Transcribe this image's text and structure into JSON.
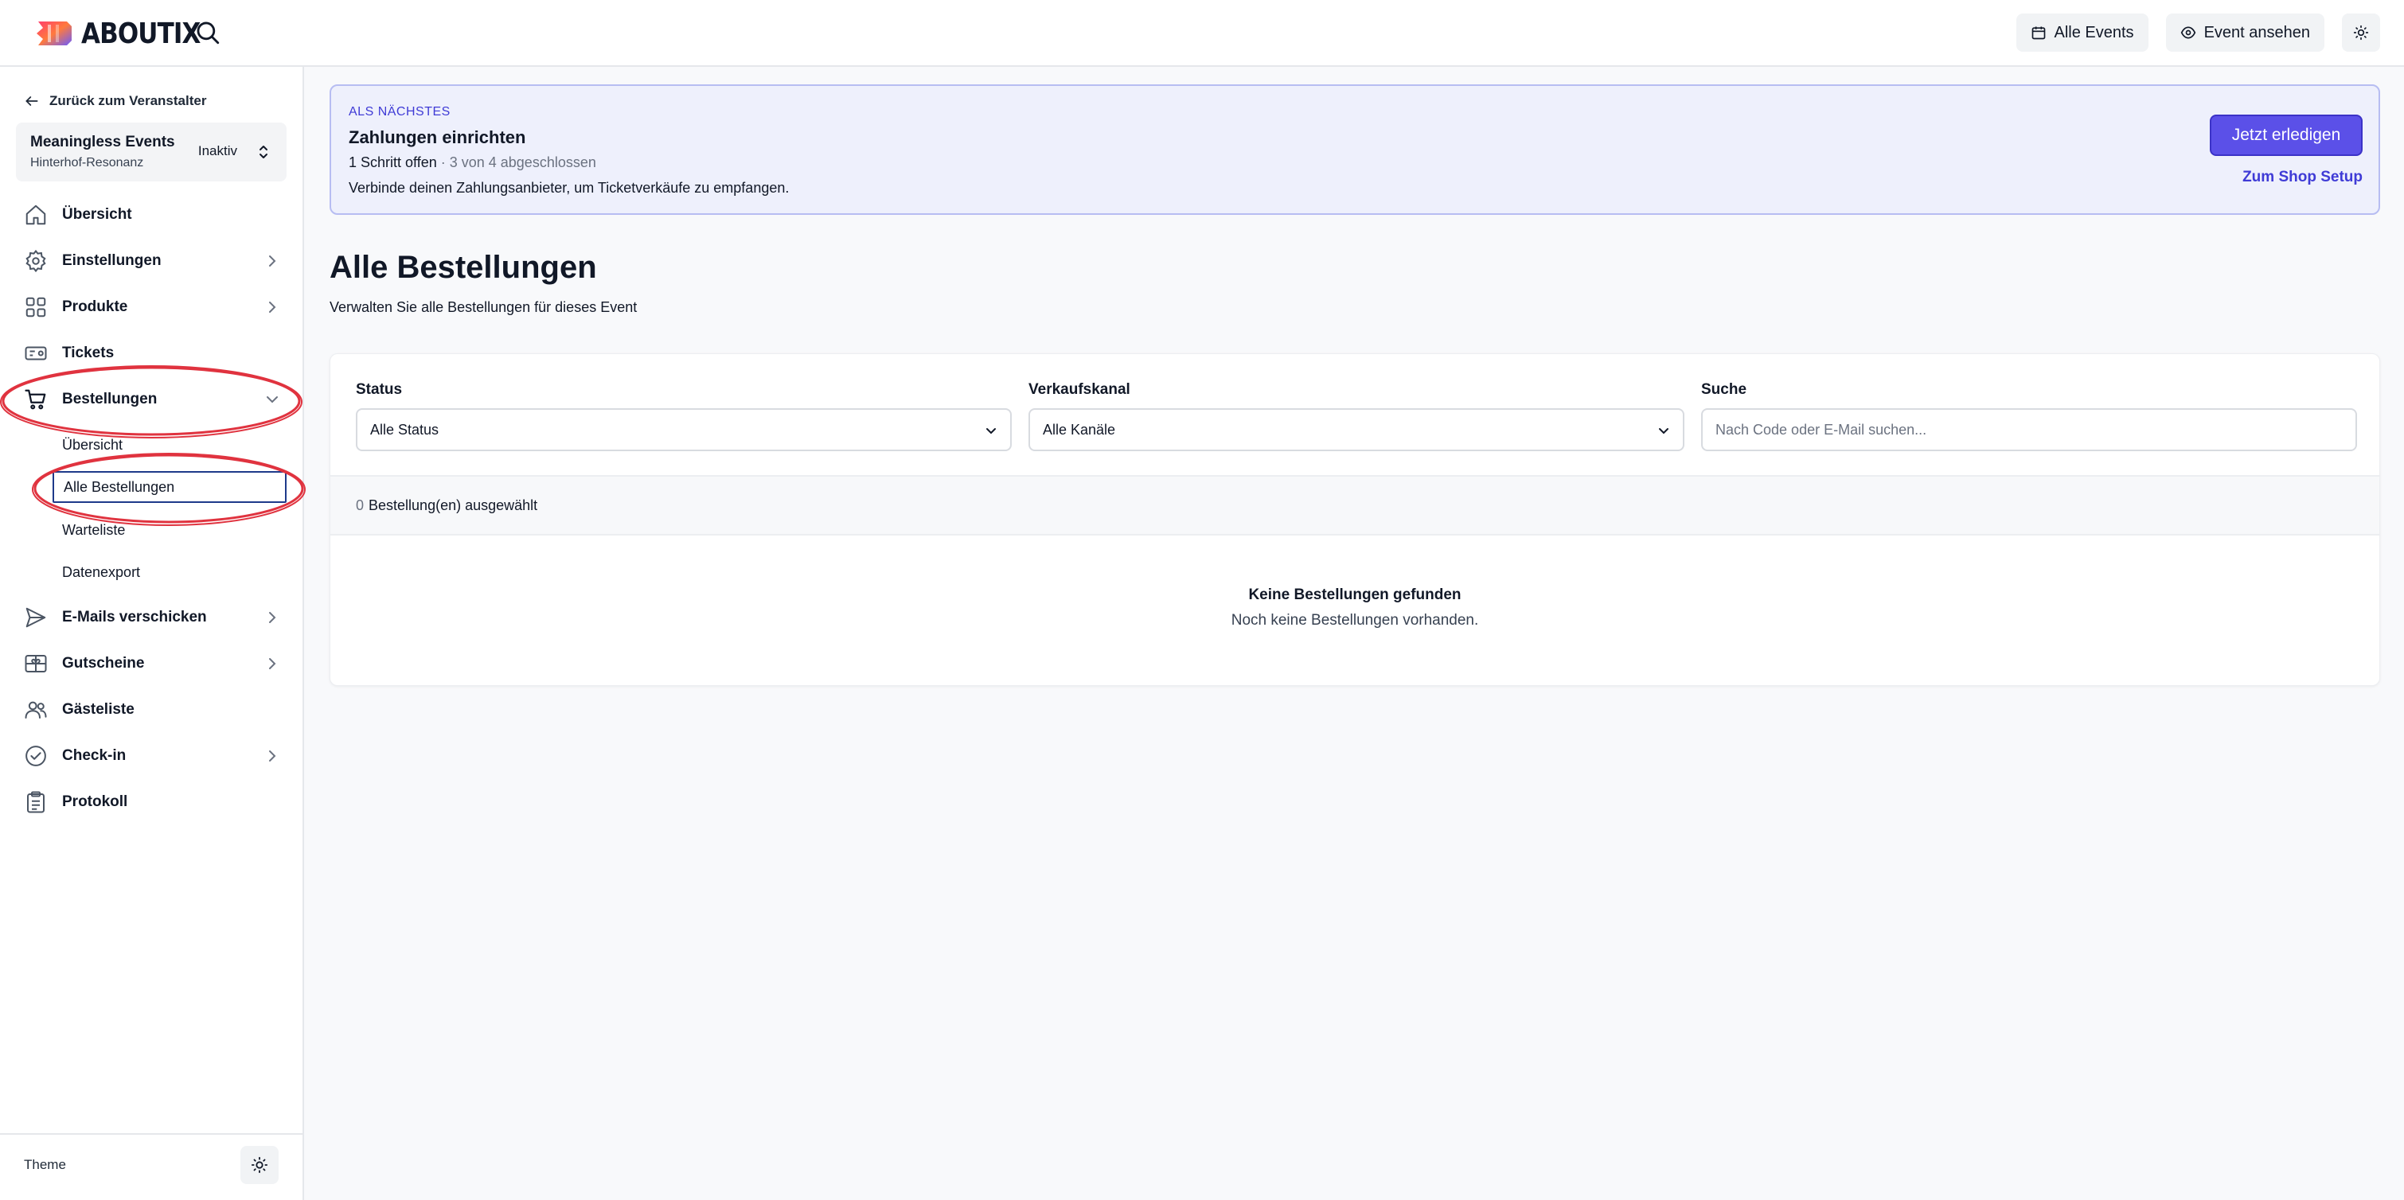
{
  "app": {
    "brand": "ABOUTIX"
  },
  "header": {
    "all_events": "Alle Events",
    "view_event": "Event ansehen"
  },
  "sidebar": {
    "back_link": "Zurück zum Veranstalter",
    "org": {
      "name": "Meaningless Events",
      "venue": "Hinterhof-Resonanz",
      "status": "Inaktiv"
    },
    "items": [
      {
        "label": "Übersicht",
        "icon": "home-icon"
      },
      {
        "label": "Einstellungen",
        "icon": "gear-icon"
      },
      {
        "label": "Produkte",
        "icon": "grid-icon"
      },
      {
        "label": "Tickets",
        "icon": "ticket-icon"
      },
      {
        "label": "Bestellungen",
        "icon": "cart-icon"
      },
      {
        "label": "E-Mails verschicken",
        "icon": "send-icon"
      },
      {
        "label": "Gutscheine",
        "icon": "voucher-icon"
      },
      {
        "label": "Gästeliste",
        "icon": "users-icon"
      },
      {
        "label": "Check-in",
        "icon": "check-circle-icon"
      },
      {
        "label": "Protokoll",
        "icon": "clipboard-icon"
      }
    ],
    "sub_items": [
      {
        "label": "Übersicht"
      },
      {
        "label": "Alle Bestellungen"
      },
      {
        "label": "Warteliste"
      },
      {
        "label": "Datenexport"
      }
    ],
    "theme_label": "Theme"
  },
  "banner": {
    "kicker": "ALS NÄCHSTES",
    "title": "Zahlungen einrichten",
    "progress_open": "1 Schritt offen",
    "progress_done": " · 3 von 4 abgeschlossen",
    "description": "Verbinde deinen Zahlungsanbieter, um Ticketverkäufe zu empfangen.",
    "primary_button": "Jetzt erledigen",
    "secondary_link": "Zum Shop Setup"
  },
  "page": {
    "title": "Alle Bestellungen",
    "subtitle": "Verwalten Sie alle Bestellungen für dieses Event"
  },
  "filters": {
    "status_label": "Status",
    "status_value": "Alle Status",
    "channel_label": "Verkaufskanal",
    "channel_value": "Alle Kanäle",
    "search_label": "Suche",
    "search_placeholder": "Nach Code oder E-Mail suchen..."
  },
  "selection": {
    "count": "0",
    "label": "Bestellung(en) ausgewählt"
  },
  "empty": {
    "title": "Keine Bestellungen gefunden",
    "subtitle": "Noch keine Bestellungen vorhanden."
  },
  "colors": {
    "accent": "#5b50e8",
    "accent_text": "#3f3bd6",
    "banner_bg": "#eef0fc",
    "annotation": "#e0333f"
  }
}
